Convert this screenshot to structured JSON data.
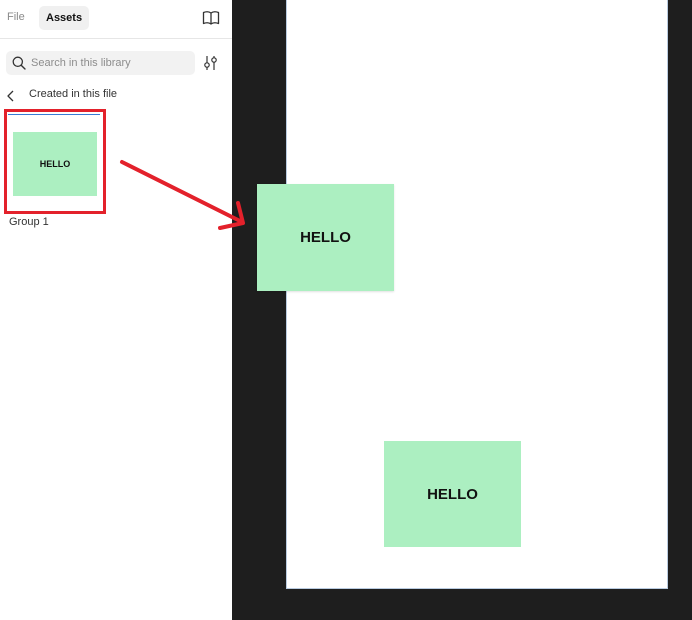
{
  "tabs": {
    "file_label": "File",
    "assets_label": "Assets"
  },
  "search": {
    "placeholder": "Search in this library",
    "value": ""
  },
  "library": {
    "section_label": "Created in this file"
  },
  "asset": {
    "thumb_text": "HELLO",
    "name": "Group 1"
  },
  "canvas": {
    "sticky_1_text": "HELLO",
    "sticky_2_text": "HELLO"
  },
  "colors": {
    "sticky_fill": "#acefc1",
    "annotation": "#e3212b",
    "canvas_bg": "#1e1e1e"
  }
}
